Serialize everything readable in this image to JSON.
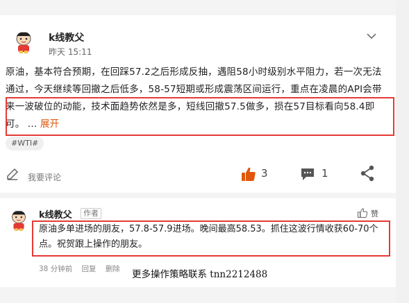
{
  "post": {
    "author": "k线教父",
    "time": "昨天 15:11",
    "body": "原油，基本符合预期，在回踩57.2之后形成反抽，遇阻58小时级别水平阻力，若一次无法通过，今天继续等回撤之后低多，58-57短期或形成震荡区间运行，重点在凌晨的API会带来一波破位的动能，技术面趋势依然是多，短线回撤57.5做多，损在57目标看向58.4即可。",
    "ellipsis": " ... ",
    "expand_label": "展开",
    "tag": "#WTI#"
  },
  "actions": {
    "comment_placeholder": "我要评论",
    "like_count": "3",
    "comment_count": "1"
  },
  "reply": {
    "author": "k线教父",
    "role": "作者",
    "like_label": "赞",
    "body": "原油多单进场的朋友，57.8-57.9进场。晚间最高58.53。抓住这波行情收获60-70个点。祝贺跟上操作的朋友。",
    "time": "38 分钟前",
    "reply_label": "回复",
    "delete_label": "删除"
  },
  "footer": {
    "contact": "更多操作策略联系 tnn2212488"
  },
  "colors": {
    "accent_orange": "#e0560a",
    "highlight_red": "#e53935"
  }
}
